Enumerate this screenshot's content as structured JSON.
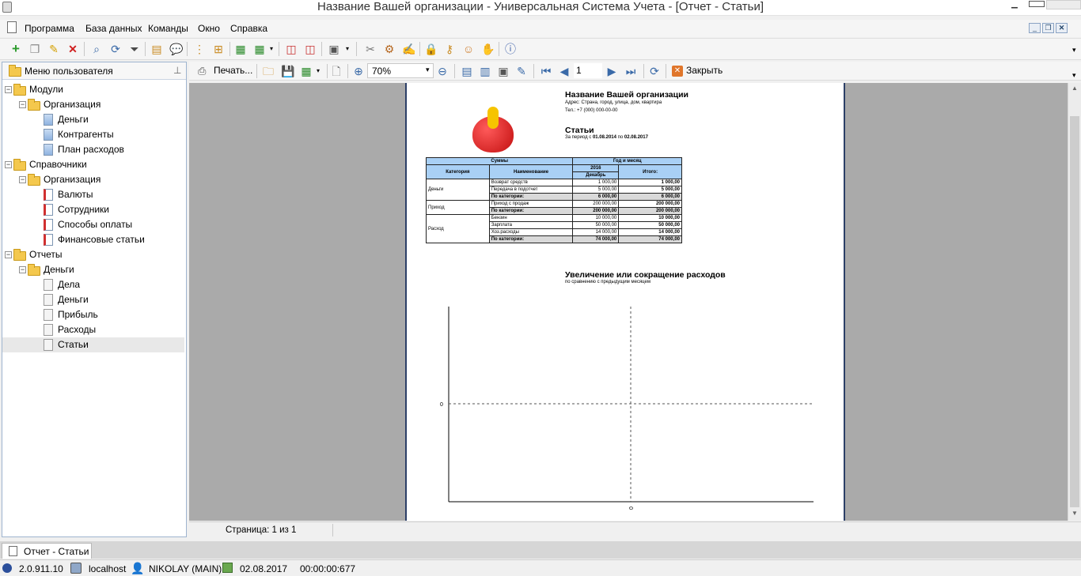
{
  "window": {
    "title": "Название Вашей организации - Универсальная Система Учета - [Отчет - Статьи]"
  },
  "menu": [
    "Программа",
    "База данных",
    "Команды",
    "Окно",
    "Справка"
  ],
  "left_panel": {
    "header": "Меню пользователя"
  },
  "tree": [
    {
      "label": "Модули",
      "level": 0,
      "icon": "folder-icon",
      "expander": "−"
    },
    {
      "label": "Организация",
      "level": 1,
      "icon": "folder-icon",
      "expander": "−"
    },
    {
      "label": "Деньги",
      "level": 2,
      "icon": "blue-doc-icon"
    },
    {
      "label": "Контрагенты",
      "level": 2,
      "icon": "blue-doc-icon"
    },
    {
      "label": "План расходов",
      "level": 2,
      "icon": "blue-doc-icon"
    },
    {
      "label": "Справочники",
      "level": 0,
      "icon": "folder-icon",
      "expander": "−"
    },
    {
      "label": "Организация",
      "level": 1,
      "icon": "folder-icon",
      "expander": "−"
    },
    {
      "label": "Валюты",
      "level": 2,
      "icon": "red-doc-icon"
    },
    {
      "label": "Сотрудники",
      "level": 2,
      "icon": "red-doc-icon"
    },
    {
      "label": "Способы оплаты",
      "level": 2,
      "icon": "red-doc-icon"
    },
    {
      "label": "Финансовые статьи",
      "level": 2,
      "icon": "red-doc-icon"
    },
    {
      "label": "Отчеты",
      "level": 0,
      "icon": "folder-icon",
      "expander": "−"
    },
    {
      "label": "Деньги",
      "level": 1,
      "icon": "folder-icon",
      "expander": "−"
    },
    {
      "label": "Дела",
      "level": 2,
      "icon": "report-doc-icon"
    },
    {
      "label": "Деньги",
      "level": 2,
      "icon": "report-doc-icon"
    },
    {
      "label": "Прибыль",
      "level": 2,
      "icon": "report-doc-icon"
    },
    {
      "label": "Расходы",
      "level": 2,
      "icon": "report-doc-icon"
    },
    {
      "label": "Статьи",
      "level": 2,
      "icon": "report-doc-icon",
      "selected": true
    }
  ],
  "report_toolbar": {
    "print": "Печать...",
    "zoom": "70%",
    "page_number": "1",
    "close": "Закрыть"
  },
  "report": {
    "org_name": "Название Вашей организации",
    "address": "Адрес: Страна, город, улица, дом, квартира",
    "phone": "Тел.: +7 (000) 000-00-00",
    "title": "Статьи",
    "period_prefix": "За период с ",
    "period_from": "01.08.2014",
    "period_mid": " по ",
    "period_to": "02.08.2017",
    "table": {
      "h_sums": "Суммы",
      "h_year_month": "Год и месяц",
      "h_category": "Категория",
      "h_name": "Наименование",
      "h_year": "2016",
      "h_month": "Декабрь",
      "h_total": "Итого:",
      "groups": [
        {
          "category": "Деньги",
          "rows": [
            {
              "name": "Возврат средств",
              "value": "1 000,00",
              "total": "1 000,00"
            },
            {
              "name": "Передача в подотчет",
              "value": "5 000,00",
              "total": "5 000,00"
            }
          ],
          "subtotal": {
            "label": "По категории:",
            "value": "6 000,00",
            "total": "6 000,00"
          }
        },
        {
          "category": "Приход",
          "rows": [
            {
              "name": "Приход с продаж",
              "value": "200 000,00",
              "total": "200 000,00"
            }
          ],
          "subtotal": {
            "label": "По категории:",
            "value": "200 000,00",
            "total": "200 000,00"
          }
        },
        {
          "category": "Расход",
          "rows": [
            {
              "name": "Бензин",
              "value": "10 000,00",
              "total": "10 000,00"
            },
            {
              "name": "Зарплата",
              "value": "50 000,00",
              "total": "50 000,00"
            },
            {
              "name": "Хоз.расходы",
              "value": "14 000,00",
              "total": "14 000,00"
            }
          ],
          "subtotal": {
            "label": "По категории:",
            "value": "74 000,00",
            "total": "74 000,00"
          }
        }
      ]
    },
    "chart_title": "Увеличение или сокращение расходов",
    "chart_subtitle": "по сравнению с предыдущим месяцем",
    "chart_y_tick": "0",
    "chart_x_tick": "0"
  },
  "page_bar": {
    "page_info": "Страница: 1 из 1"
  },
  "tabs": [
    {
      "label": "Отчет - Статьи",
      "active": true
    }
  ],
  "status": {
    "version": "2.0.911.10",
    "host": "localhost",
    "user": "NIKOLAY (MAIN)",
    "date": "02.08.2017",
    "timer": "00:00:00:677"
  },
  "colors": {
    "panel_border": "#9eb4cf",
    "viewer_bg": "#aaaaaa",
    "table_header": "#a9d0f5",
    "table_subtotal": "#d9d9d9",
    "page_frame": "#2c3f67"
  }
}
